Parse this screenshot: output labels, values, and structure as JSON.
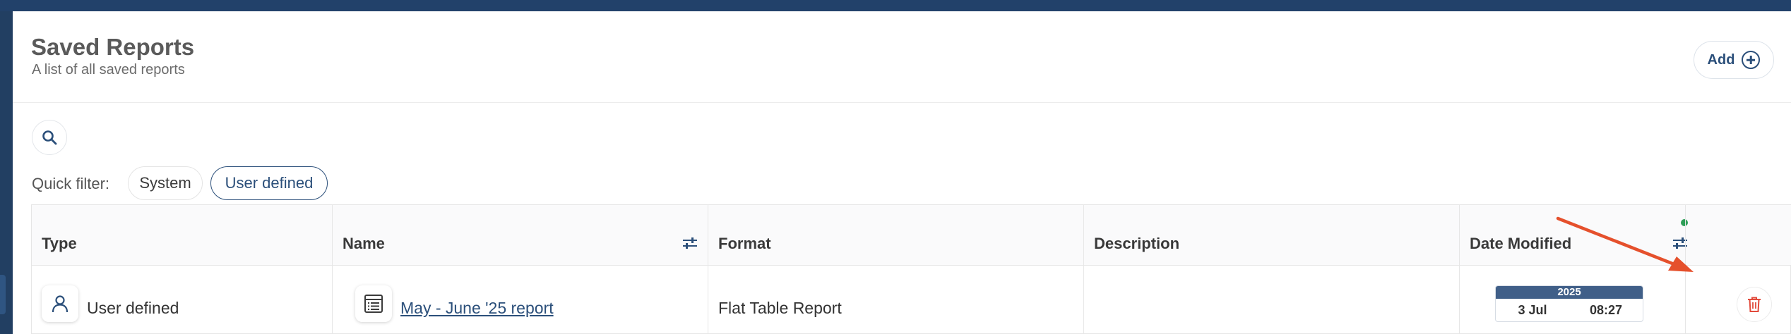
{
  "header": {
    "title": "Saved Reports",
    "subtitle": "A list of all saved reports",
    "add_label": "Add"
  },
  "filters": {
    "quick_filter_label": "Quick filter:",
    "chips": [
      "System",
      "User defined"
    ],
    "active_chip": "User defined"
  },
  "table": {
    "columns": [
      "Type",
      "Name",
      "Format",
      "Description",
      "Date Modified"
    ],
    "rows": [
      {
        "type": "User defined",
        "name": "May - June '25 report",
        "format": "Flat Table Report",
        "description": "",
        "date": {
          "year": "2025",
          "day": "3 Jul",
          "time": "08:27"
        }
      }
    ]
  },
  "icons": {
    "add": "plus-circle-icon",
    "search": "search-icon",
    "type": "user-icon",
    "name": "report-sheet-icon",
    "column_filter": "sliders-icon",
    "delete": "trash-icon"
  },
  "colors": {
    "accent": "#2b4f7a",
    "delete": "#e24a3b",
    "filter_active_dot": "#2e9e57",
    "annotation_arrow": "#e5502c"
  }
}
